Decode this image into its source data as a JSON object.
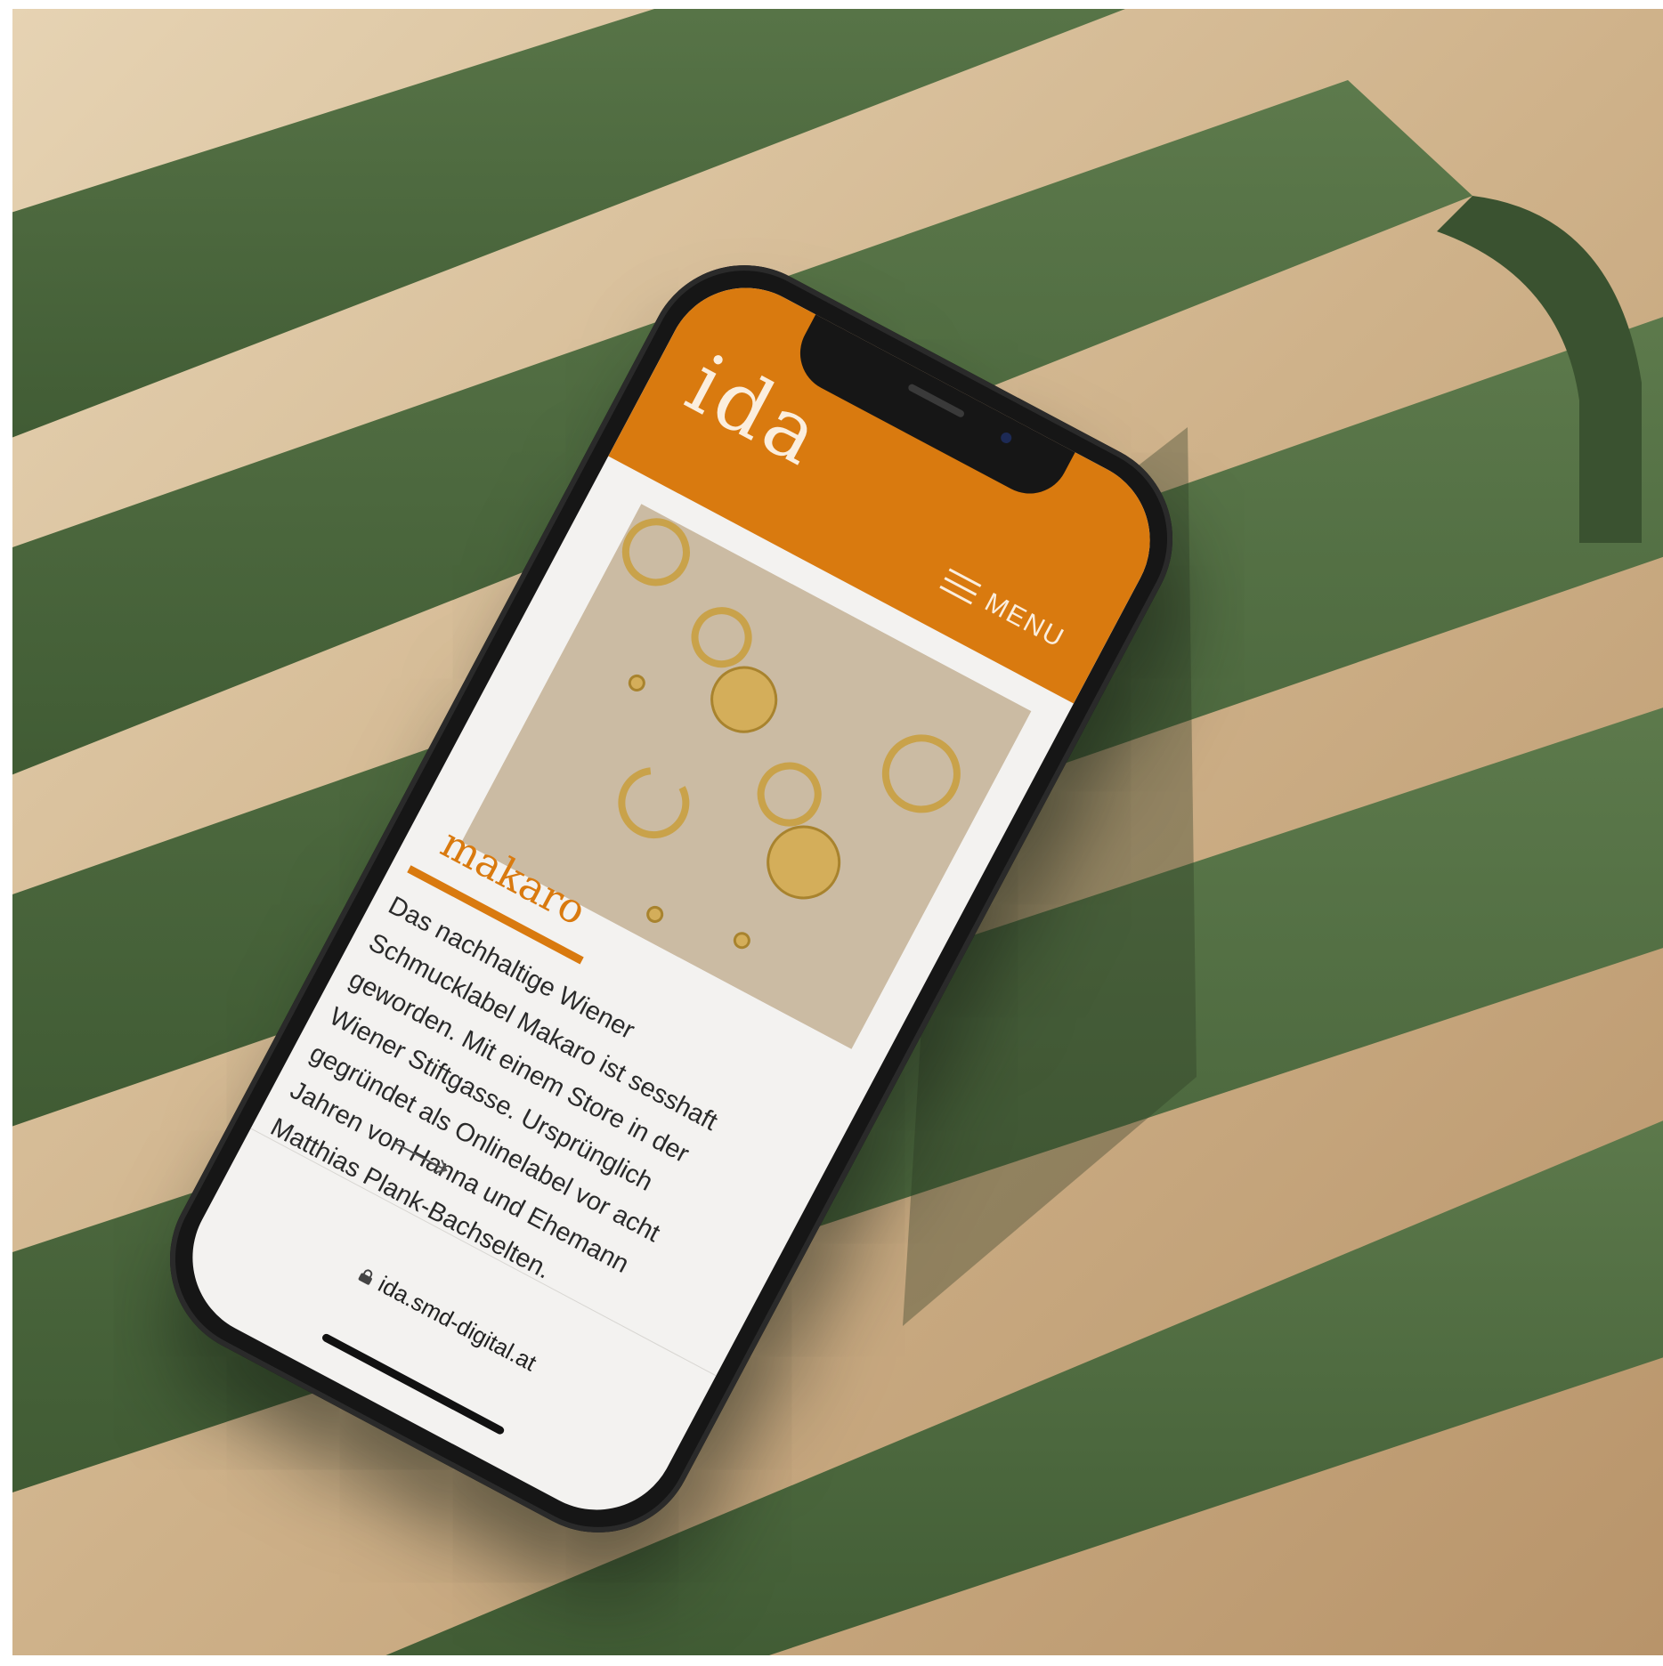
{
  "site": {
    "logo": "ida",
    "menu_label": "MENU",
    "url": "ida.smd-digital.at"
  },
  "article": {
    "title": "makaro",
    "body": "Das nachhaltige Wiener Schmucklabel Makaro ist sesshaft geworden. Mit einem Store in der Wiener Stiftgasse. Ursprünglich gegründet als Onlinelabel vor acht Jahren von Hanna und Ehemann Matthias Plank-Bachselten."
  },
  "icons": {
    "menu": "hamburger-icon",
    "read_more": "arrow-right-icon",
    "secure": "lock-icon"
  },
  "colors": {
    "brand_orange": "#d97a0f",
    "bench_green": "#4e6a3f",
    "wood": "#d9c2a0",
    "screen_bg": "#f3f2f0"
  }
}
